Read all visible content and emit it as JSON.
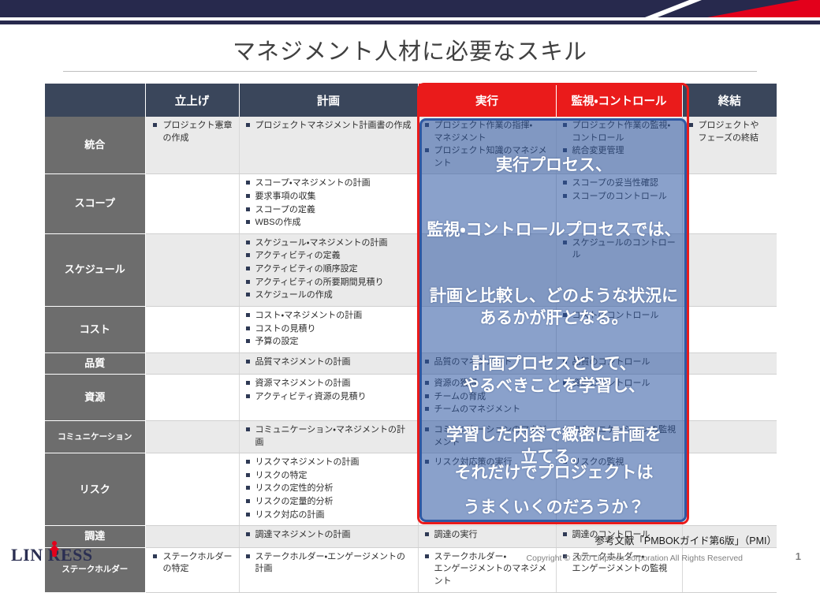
{
  "banner": {
    "navy_color": "#27294d",
    "red_color": "#e3001b"
  },
  "header": {
    "title": "マネジメント人材に必要なスキル"
  },
  "table": {
    "columns": [
      {
        "key": "area",
        "label": "",
        "highlight": false
      },
      {
        "key": "init",
        "label": "立上げ",
        "highlight": false
      },
      {
        "key": "plan",
        "label": "計画",
        "highlight": false
      },
      {
        "key": "exec",
        "label": "実行",
        "highlight": true
      },
      {
        "key": "mon",
        "label": "監視・コントロール",
        "highlight": true
      },
      {
        "key": "close",
        "label": "終結",
        "highlight": false
      }
    ],
    "rows": [
      {
        "area": "統合",
        "init": [
          "プロジェクト憲章\nの作成"
        ],
        "plan": [
          "プロジェクトマネジメント計画書の作成"
        ],
        "exec": [
          "プロジェクト作業の指揮・\nマネジメント",
          "プロジェクト知識のマネジメント"
        ],
        "mon": [
          "プロジェクト作業の監視・\nコントロール",
          "統合変更管理"
        ],
        "close": [
          "プロジェクトや\nフェーズの終結"
        ]
      },
      {
        "area": "スコープ",
        "init": [],
        "plan": [
          "スコープ・マネジメントの計画",
          "要求事項の収集",
          "スコープの定義",
          "WBSの作成"
        ],
        "exec": [],
        "mon": [
          "スコープの妥当性確認",
          "スコープのコントロール"
        ],
        "close": []
      },
      {
        "area": "スケジュール",
        "init": [],
        "plan": [
          "スケジュール・マネジメントの計画",
          "アクティビティの定義",
          "アクティビティの順序設定",
          "アクティビティの所要期間見積り",
          "スケジュールの作成"
        ],
        "exec": [],
        "mon": [
          "スケジュールのコントロール"
        ],
        "close": []
      },
      {
        "area": "コスト",
        "init": [],
        "plan": [
          "コスト・マネジメントの計画",
          "コストの見積り",
          "予算の設定"
        ],
        "exec": [],
        "mon": [
          "コストのコントロール"
        ],
        "close": []
      },
      {
        "area": "品質",
        "init": [],
        "plan": [
          "品質マネジメントの計画"
        ],
        "exec": [
          "品質のマネジメント"
        ],
        "mon": [
          "品質のコントロール"
        ],
        "close": []
      },
      {
        "area": "資源",
        "init": [],
        "plan": [
          "資源マネジメントの計画",
          "アクティビティ資源の見積り"
        ],
        "exec": [
          "資源の獲得",
          "チームの育成",
          "チームのマネジメント"
        ],
        "mon": [
          "資源のコントロール"
        ],
        "close": []
      },
      {
        "area": "コミュニケーション",
        "area_small": true,
        "init": [],
        "plan": [
          "コミュニケーション・マネジメントの計画"
        ],
        "exec": [
          "コミュニケーションのマネジメント"
        ],
        "mon": [
          "コミュニケーションの監視"
        ],
        "close": []
      },
      {
        "area": "リスク",
        "init": [],
        "plan": [
          "リスクマネジメントの計画",
          "リスクの特定",
          "リスクの定性的分析",
          "リスクの定量的分析",
          "リスク対応の計画"
        ],
        "exec": [
          "リスク対応策の実行"
        ],
        "mon": [
          "リスクの監視"
        ],
        "close": []
      },
      {
        "area": "調達",
        "init": [],
        "plan": [
          "調達マネジメントの計画"
        ],
        "exec": [
          "調達の実行"
        ],
        "mon": [
          "調達のコントロール"
        ],
        "close": []
      },
      {
        "area": "ステークホルダー",
        "area_small": true,
        "init": [
          "ステークホルダー\nの特定"
        ],
        "plan": [
          "ステークホルダー・エンゲージメントの計画"
        ],
        "exec": [
          "ステークホルダー・\nエンゲージメントのマネジメント"
        ],
        "mon": [
          "ステークホルダー・\nエンゲージメントの監視"
        ],
        "close": []
      }
    ]
  },
  "overlay": {
    "highlight_border_color": "#ea1b1b",
    "panel_color": "#2f58a2",
    "messages": [
      "実行プロセス、",
      "監視・コントロールプロセスでは、",
      "計画と比較し、どのような状況に\nあるかが肝となる。",
      "計画プロセスとして、\nやるべきことを学習し、",
      "学習した内容で緻密に計画を\n立てる。",
      "それだけでプロジェクトは",
      "うまくいくのだろうか？"
    ]
  },
  "footer": {
    "reference": "参考文献「PMBOKガイド第6版」（PMI）",
    "copyright": "Copyright © 2020 Linpress corporation All Rights Reserved",
    "page_number": "1",
    "logo_text": "LIN RESS"
  }
}
